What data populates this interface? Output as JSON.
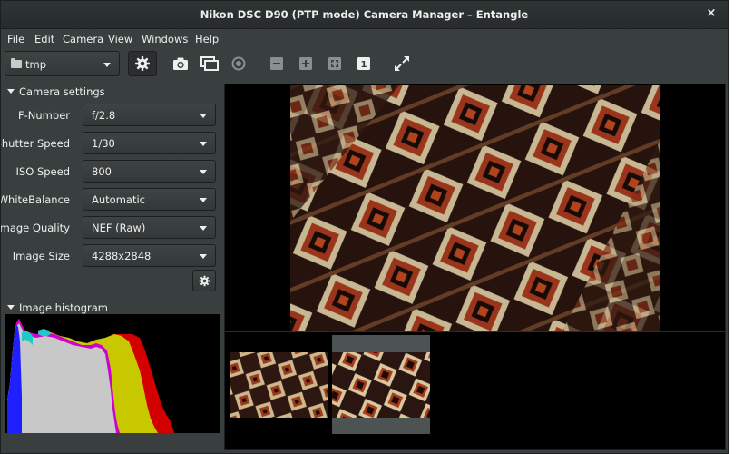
{
  "window": {
    "title": "Nikon DSC D90 (PTP mode) Camera Manager – Entangle",
    "close_glyph": "×"
  },
  "menu": [
    "File",
    "Edit",
    "Camera",
    "View",
    "Windows",
    "Help"
  ],
  "toolbar": {
    "folder": "tmp",
    "icons": [
      "settings-gear-icon",
      "camera-icon",
      "preview-icon",
      "record-icon",
      "zoom-out-icon",
      "zoom-in-icon",
      "zoom-fit-icon",
      "zoom-normal-icon",
      "fullscreen-icon"
    ],
    "zoom_normal_label": "1"
  },
  "camera_settings": {
    "header": "Camera settings",
    "rows": [
      {
        "label": "F-Number",
        "value": "f/2.8"
      },
      {
        "label": "Shutter Speed",
        "value": "1/30"
      },
      {
        "label": "ISO Speed",
        "value": "800"
      },
      {
        "label": "WhiteBalance",
        "value": "Automatic"
      },
      {
        "label": "Image Quality",
        "value": "NEF (Raw)"
      },
      {
        "label": "Image Size",
        "value": "4288x2848"
      }
    ]
  },
  "histogram": {
    "header": "Image histogram",
    "colors": {
      "red": "#d40000",
      "yellow": "#c8c800",
      "magenta": "#d000d0",
      "gray": "#c8c8c8",
      "blue": "#2020ff",
      "cyan": "#20c8c8"
    }
  },
  "colors": {
    "window_bg": "#393f3f",
    "titlebar_bg": "#2b2f2f",
    "text": "#eeeeec",
    "preview_bg": "#000000"
  }
}
